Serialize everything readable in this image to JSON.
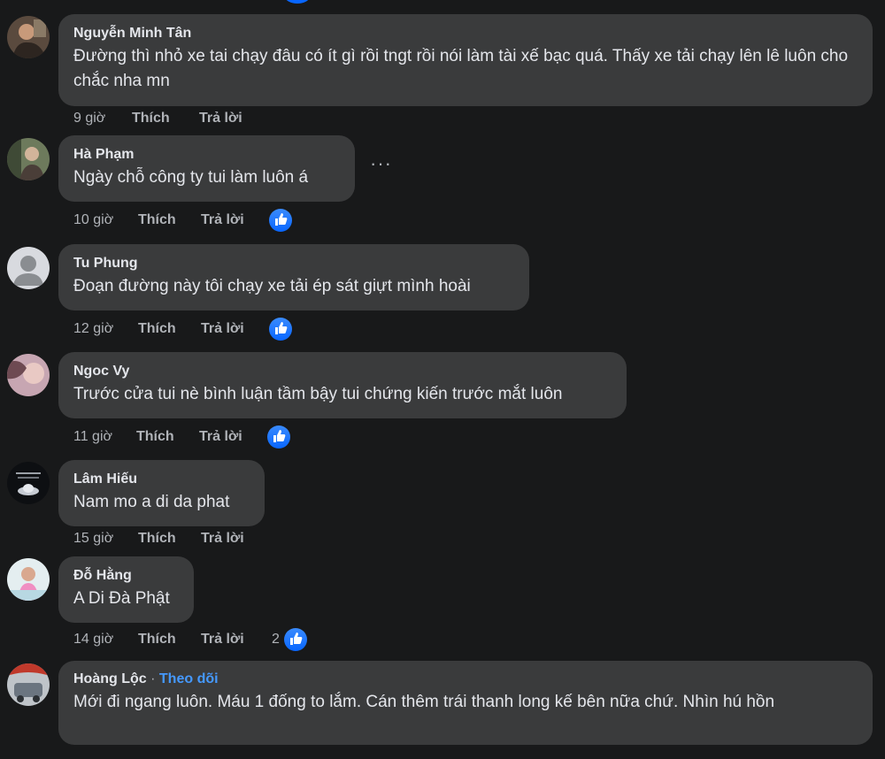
{
  "comments": [
    {
      "author": "Nguyễn Minh Tân",
      "text": "Đường thì nhỏ xe tai chạy đâu có ít gì rồi tngt rồi nói làm tài xế bạc quá. Thấy xe tải chạy lên lê luôn cho chắc nha mn",
      "time": "9 giờ",
      "like": "Thích",
      "reply": "Trả lời"
    },
    {
      "author": "Hà Phạm",
      "text": "Ngày chỗ công ty tui làm luôn á",
      "time": "10 giờ",
      "like": "Thích",
      "reply": "Trả lời",
      "more_menu": "···"
    },
    {
      "author": "Tu Phung",
      "text": "Đoạn đường này tôi chạy xe tải ép sát giựt mình hoài",
      "time": "12 giờ",
      "like": "Thích",
      "reply": "Trả lời"
    },
    {
      "author": "Ngoc Vy",
      "text": "Trước cửa tui nè bình luận tầm bậy tui chứng kiến trước mắt luôn",
      "time": "11 giờ",
      "like": "Thích",
      "reply": "Trả lời"
    },
    {
      "author": "Lâm Hiếu",
      "text": "Nam mo a di da phat",
      "time": "15 giờ",
      "like": "Thích",
      "reply": "Trả lời"
    },
    {
      "author": "Đỗ Hằng",
      "text": "A Di Đà Phật",
      "time": "14 giờ",
      "like": "Thích",
      "reply": "Trả lời",
      "reaction_count": "2"
    },
    {
      "author": "Hoàng Lộc",
      "separator": "·",
      "follow": "Theo dõi",
      "text": "Mới đi ngang luôn. Máu 1 đống to lắm. Cán thêm trái thanh long kế bên nữa chứ. Nhìn hú hồn"
    }
  ],
  "colors": {
    "background": "#18191a",
    "bubble": "#3a3b3c",
    "text": "#e4e6eb",
    "secondary": "#b0b3b8",
    "accent": "#4599ff",
    "like_blue": "#0866ff"
  },
  "icons": {
    "reaction": "thumbs-up-icon",
    "more": "more-options-icon"
  }
}
